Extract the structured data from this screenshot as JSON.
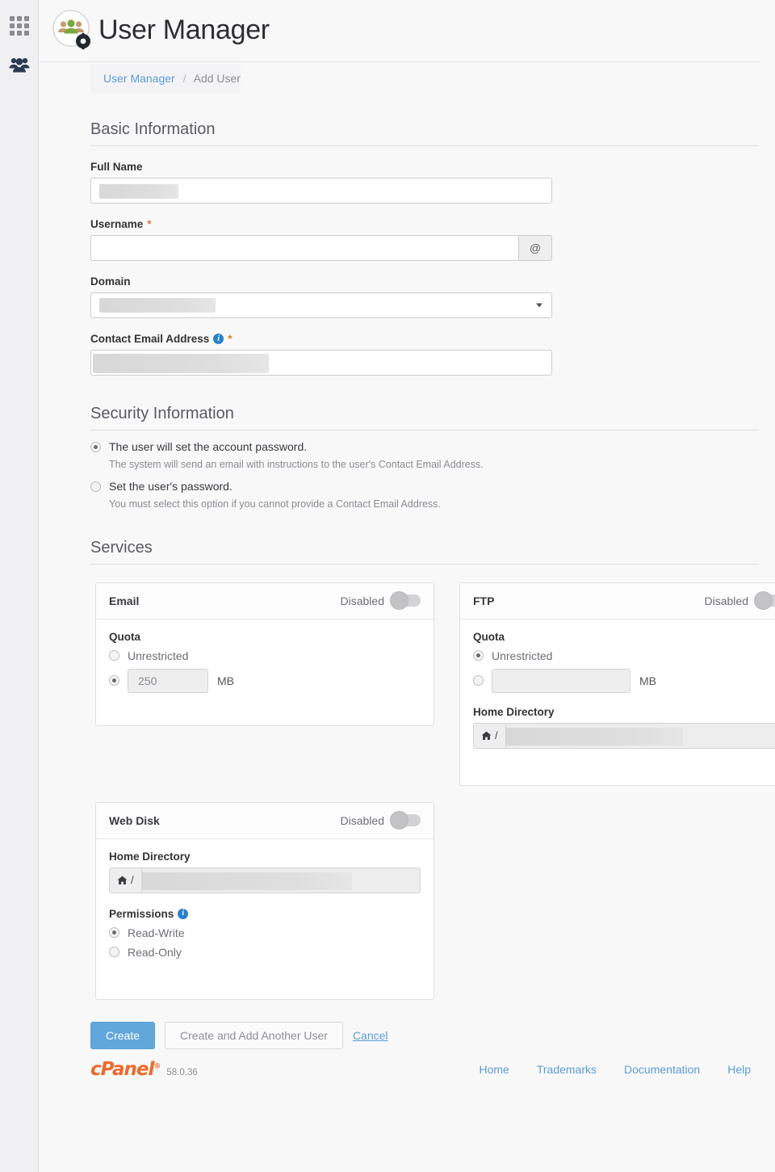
{
  "sidebar": {
    "items": [
      {
        "name": "apps-grid",
        "icon": "grid-icon"
      },
      {
        "name": "user-manager",
        "icon": "users-icon"
      }
    ]
  },
  "header": {
    "title": "User Manager",
    "icon": "user-manager-icon"
  },
  "breadcrumb": {
    "parent": "User Manager",
    "separator": "/",
    "current": "Add User"
  },
  "basic_information": {
    "heading": "Basic Information",
    "full_name": {
      "label": "Full Name",
      "value": "",
      "redacted": true
    },
    "username": {
      "label": "Username",
      "required": "*",
      "value": "",
      "addon": "@"
    },
    "domain": {
      "label": "Domain",
      "value": "",
      "redacted": true
    },
    "contact_email": {
      "label": "Contact Email Address",
      "required": "*",
      "value": "",
      "redacted": true,
      "info": "i"
    }
  },
  "security_information": {
    "heading": "Security Information",
    "options": [
      {
        "label": "The user will set the account password.",
        "help": "The system will send an email with instructions to the user's Contact Email Address.",
        "selected": true
      },
      {
        "label": "Set the user's password.",
        "help": "You must select this option if you cannot provide a Contact Email Address.",
        "selected": false
      }
    ]
  },
  "services": {
    "heading": "Services",
    "email": {
      "title": "Email",
      "toggle_label": "Disabled",
      "enabled": false,
      "quota_label": "Quota",
      "unrestricted_label": "Unrestricted",
      "unrestricted_selected": false,
      "quota_value": "250",
      "quota_unit": "MB"
    },
    "ftp": {
      "title": "FTP",
      "toggle_label": "Disabled",
      "enabled": false,
      "quota_label": "Quota",
      "unrestricted_label": "Unrestricted",
      "unrestricted_selected": true,
      "quota_value": "",
      "quota_unit": "MB",
      "home_dir_label": "Home Directory",
      "home_dir_prefix": "/",
      "home_dir_value": ""
    },
    "webdisk": {
      "title": "Web Disk",
      "toggle_label": "Disabled",
      "enabled": false,
      "home_dir_label": "Home Directory",
      "home_dir_prefix": "/",
      "home_dir_value": "",
      "permissions_label": "Permissions",
      "permissions_info": "i",
      "permissions": [
        {
          "label": "Read-Write",
          "selected": true
        },
        {
          "label": "Read-Only",
          "selected": false
        }
      ]
    }
  },
  "actions": {
    "create": "Create",
    "create_and_add": "Create and Add Another User",
    "cancel": "Cancel"
  },
  "footer": {
    "brand": "cPanel",
    "trademark": "®",
    "version": "58.0.36",
    "links": [
      {
        "label": "Home"
      },
      {
        "label": "Trademarks"
      },
      {
        "label": "Documentation"
      },
      {
        "label": "Help"
      }
    ]
  },
  "colors": {
    "accent_blue": "#5b9bd5",
    "primary_button": "#62a7db",
    "required_orange": "#d9802b",
    "info_blue": "#2980c9",
    "cpanel_orange": "#ec6a2c"
  }
}
